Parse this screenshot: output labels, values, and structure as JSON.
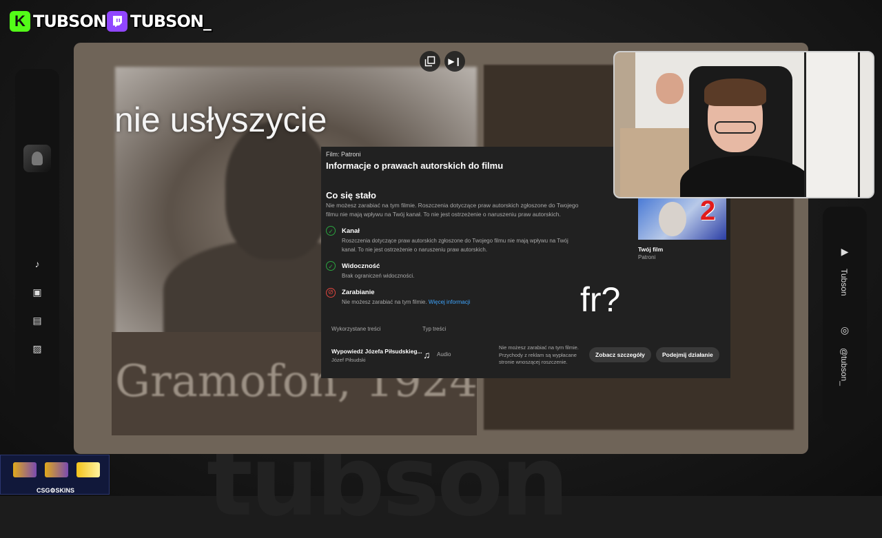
{
  "brands": {
    "kick": {
      "logo": "K",
      "name": "TUBSON",
      "color": "#53fc18"
    },
    "twitch": {
      "logo": "⌂",
      "name": "TUBSON_",
      "color": "#9146ff"
    }
  },
  "video": {
    "subtitle": "nie usłyszycie",
    "caption": "Gramofon, 1924",
    "overlay_text": "fr?"
  },
  "dialog": {
    "film_label": "Film: Patroni",
    "title": "Informacje o prawach autorskich do filmu",
    "section": "Co się stało",
    "description": "Nie możesz zarabiać na tym filmie. Roszczenia dotyczące praw autorskich zgłoszone do Twojego filmu nie mają wpływu na Twój kanał. To nie jest ostrzeżenie o naruszeniu praw autorskich.",
    "items": [
      {
        "title": "Kanał",
        "text": "Roszczenia dotyczące praw autorskich zgłoszone do Twojego filmu nie mają wpływu na Twój kanał. To nie jest ostrzeżenie o naruszeniu praw autorskich."
      },
      {
        "title": "Widoczność",
        "text": "Brak ograniczeń widoczności."
      },
      {
        "title": "Zarabianie",
        "text": "Nie możesz zarabiać na tym filmie.",
        "link": "Więcej informacji"
      }
    ],
    "columns": {
      "content": "Wykorzystane treści",
      "type": "Typ treści"
    },
    "row": {
      "title": "Wypowiedź Józefa Piłsudskieg...",
      "author": "Józef Piłsudski",
      "type": "Audio",
      "message": "Nie możesz zarabiać na tym filmie. Przychody z reklam są wypłacane stronie wnoszącej roszczenie.",
      "details_button": "Zobacz szczegóły",
      "action_button": "Podejmij działanie"
    },
    "thumb": {
      "number": "2",
      "title": "Twój film",
      "subtitle": "Patroni"
    }
  },
  "right_sidebar": {
    "youtube_name": "Tubson",
    "instagram_name": "@tubson_"
  },
  "skins": {
    "label": "CSG⚙SKINS"
  },
  "watermark": "tubson"
}
